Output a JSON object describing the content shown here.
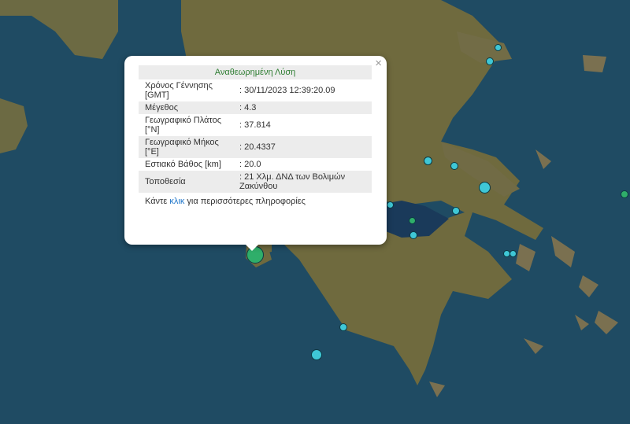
{
  "popup": {
    "title": "Αναθεωρημένη Λύση",
    "close": "×",
    "rows": [
      {
        "label": "Χρόνος Γέννησης [GMT]",
        "value": ": 30/11/2023 12:39:20.09"
      },
      {
        "label": "Μέγεθος",
        "value": ": 4.3"
      },
      {
        "label": "Γεωγραφικό Πλάτος [°N]",
        "value": ": 37.814"
      },
      {
        "label": "Γεωγραφικό Μήκος [°E]",
        "value": ": 20.4337"
      },
      {
        "label": "Εστιακό Βάθος [km]",
        "value": ": 20.0"
      },
      {
        "label": "Τοποθεσία",
        "value": ": 21 Χλμ. ΔΝΔ των Βολιμών Ζακύνθου"
      }
    ],
    "footer_prefix": "Κάντε ",
    "footer_link": "κλικ",
    "footer_suffix": " για περισσότερες πληροφορίες"
  },
  "colors": {
    "sea": "#1f4b63",
    "land": "#6f6a3e",
    "marker_cyan": "#3fc7d6",
    "marker_green": "#2fae6a",
    "title_green": "#2e7d32",
    "link_blue": "#1a73c9"
  }
}
